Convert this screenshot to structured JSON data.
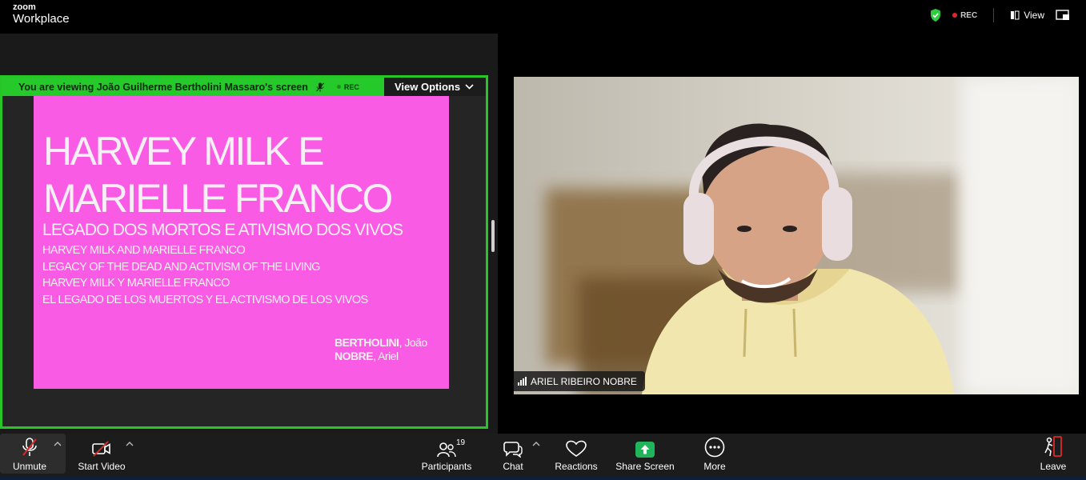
{
  "app": {
    "brand_line1": "zoom",
    "brand_line2": "Workplace",
    "rec_label": "REC",
    "view_label": "View"
  },
  "share": {
    "banner_text": "You are viewing  João Guilherme Bertholini Massaro's screen",
    "rec_label": "REC",
    "view_options_label": "View Options"
  },
  "slide": {
    "title_line1": "HARVEY MILK E",
    "title_line2": "MARIELLE FRANCO",
    "subtitle": "LEGADO DOS MORTOS E ATIVISMO DOS VIVOS",
    "line1": "HARVEY MILK AND MARIELLE FRANCO",
    "line2": "LEGACY OF THE DEAD AND ACTIVISM OF THE LIVING",
    "line3": "HARVEY MILK Y MARIELLE FRANCO",
    "line4": "EL LEGADO DE LOS MUERTOS Y EL ACTIVISMO DE LOS VIVOS",
    "author1_last": "BERTHOLINI",
    "author1_first": ", João",
    "author2_last": "NOBRE",
    "author2_first": ", Ariel",
    "background_color": "#f95be5"
  },
  "video": {
    "participant_name": "ARIEL RIBEIRO NOBRE"
  },
  "toolbar": {
    "unmute_label": "Unmute",
    "start_video_label": "Start Video",
    "participants_label": "Participants",
    "participants_count": "19",
    "chat_label": "Chat",
    "reactions_label": "Reactions",
    "share_screen_label": "Share Screen",
    "more_label": "More",
    "leave_label": "Leave"
  },
  "colors": {
    "accent_green": "#25c92a",
    "share_screen_green": "#20b55a",
    "leave_red": "#e02828",
    "toolbar_bg": "#1c1c1c"
  }
}
